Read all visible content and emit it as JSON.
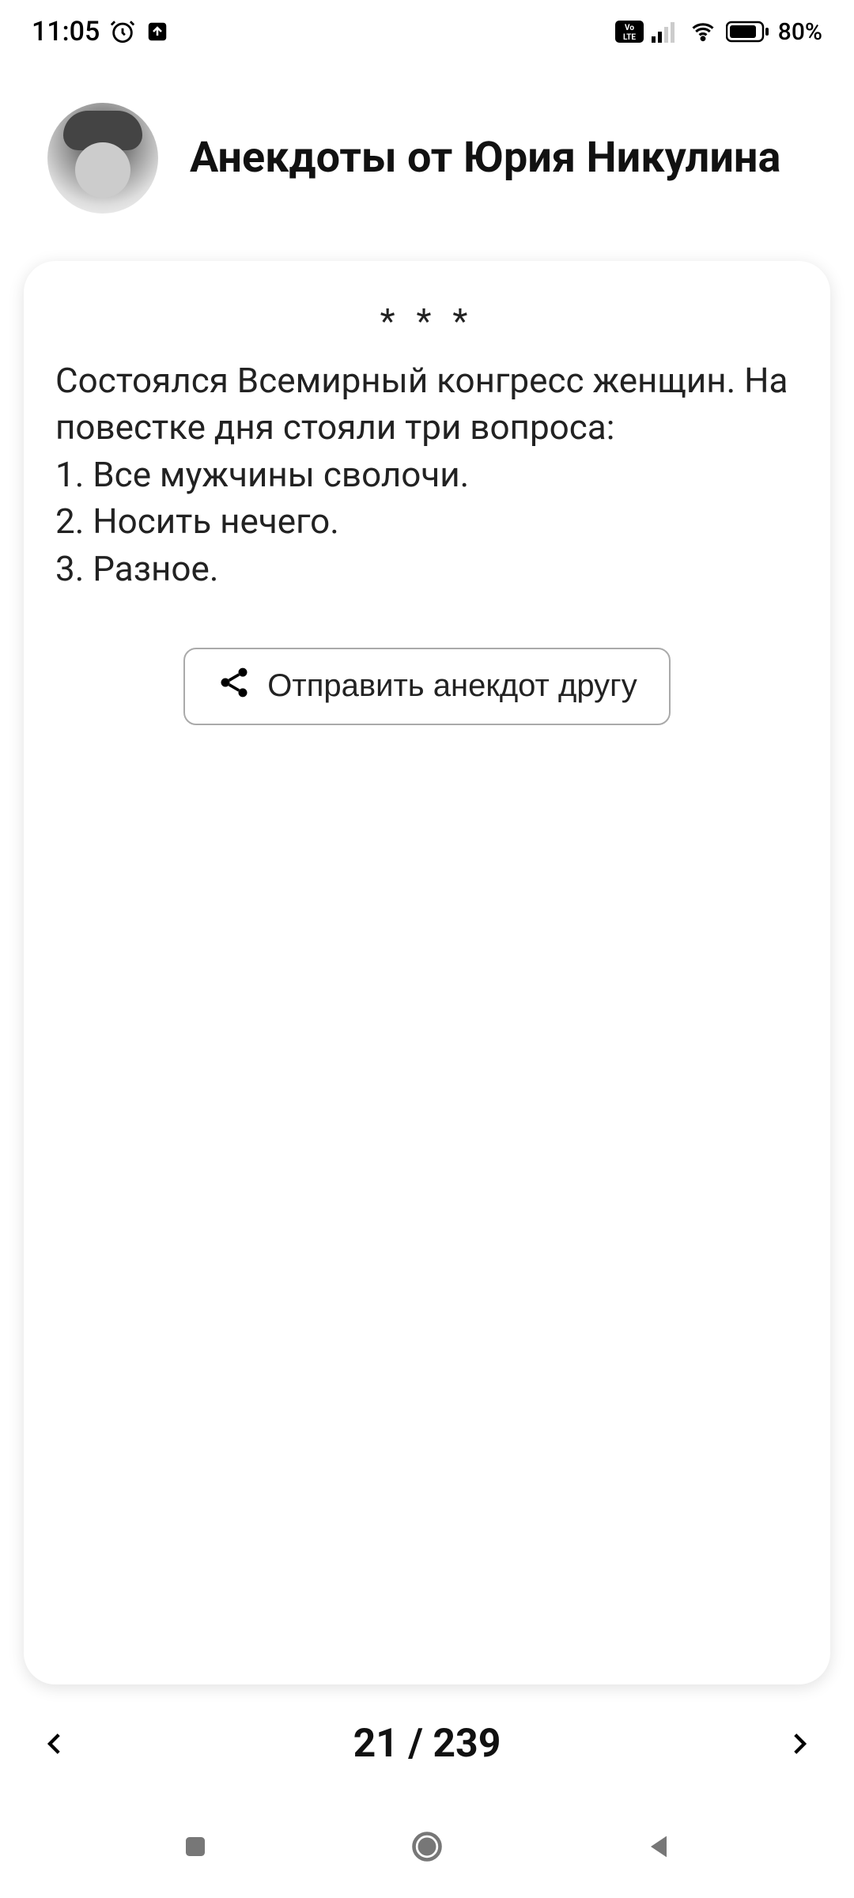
{
  "status_bar": {
    "time": "11:05",
    "battery_pct": "80%"
  },
  "header": {
    "title": "Анекдоты от Юрия Никулина"
  },
  "card": {
    "stars": "* * *",
    "joke_text": "Состоялся Всемирный конгресс женщин. На повестке дня стояли три вопроса:\n1. Все мужчины сволочи.\n2. Носить нечего.\n3. Разное.",
    "share_label": "Отправить анекдот другу"
  },
  "pager": {
    "current": 21,
    "total": 239,
    "display": "21 / 239"
  }
}
